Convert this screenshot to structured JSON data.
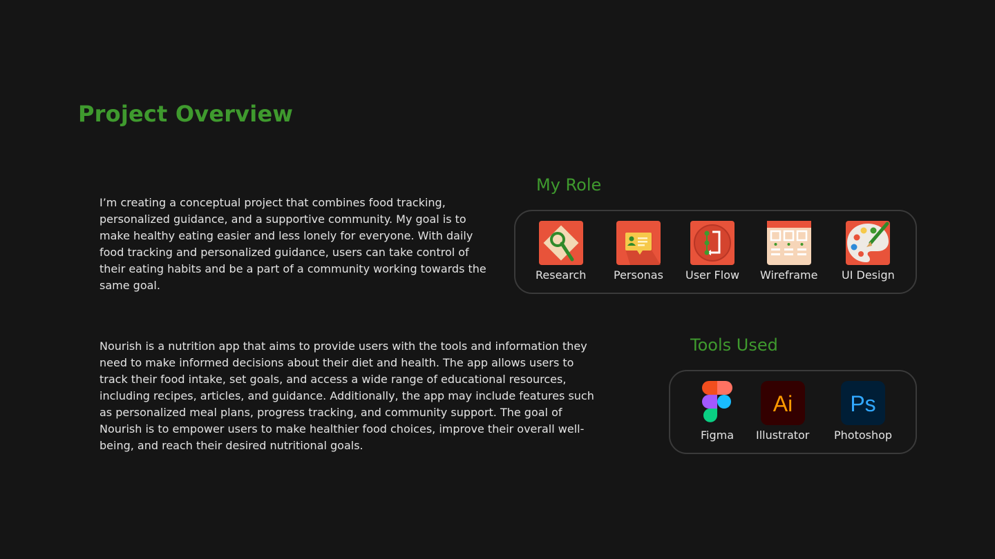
{
  "page": {
    "title": "Project Overview",
    "intro": "I’m creating a conceptual project that combines food tracking, personalized guidance, and a supportive community. My goal is to make healthy eating easier and less lonely for everyone. With daily food tracking and personalized guidance, users can take control of their eating habits and be a part of a community working towards the same goal.",
    "description": "Nourish is a nutrition app that aims to provide users with the tools and information they need to make informed decisions about their diet and health. The app allows users to track their food intake, set goals, and access a wide range of educational resources, including recipes, articles, and guidance. Additionally, the app may include features such as personalized meal plans, progress tracking, and community support. The goal of Nourish is to empower users to make healthier food choices, improve their overall well-being, and reach their desired nutritional goals."
  },
  "role": {
    "title": "My Role",
    "items": [
      {
        "label": "Research",
        "icon": "research-icon"
      },
      {
        "label": "Personas",
        "icon": "personas-icon"
      },
      {
        "label": "User Flow",
        "icon": "user-flow-icon"
      },
      {
        "label": "Wireframe",
        "icon": "wireframe-icon"
      },
      {
        "label": "UI Design",
        "icon": "ui-design-palette-icon"
      }
    ]
  },
  "tools": {
    "title": "Tools Used",
    "items": [
      {
        "label": "Figma",
        "icon": "figma-icon"
      },
      {
        "label": "Illustrator",
        "icon": "illustrator-icon",
        "glyph": "Ai"
      },
      {
        "label": "Photoshop",
        "icon": "photoshop-icon",
        "glyph": "Ps"
      }
    ]
  },
  "colors": {
    "background": "#151515",
    "accent": "#3f9a2e",
    "panel_border": "#3a3a3a",
    "icon_red": "#e8533a"
  }
}
